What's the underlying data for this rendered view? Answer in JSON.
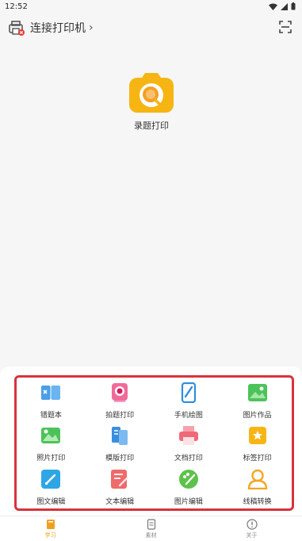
{
  "status": {
    "time": "12:52"
  },
  "header": {
    "connect_label": "连接打印机",
    "chevron": "›"
  },
  "center_app": {
    "label": "录题打印",
    "icon": "camera-search-icon",
    "color": "#f7b514"
  },
  "functions": [
    {
      "label": "错题本",
      "icon": "mistake-book-icon",
      "color": "#4a9fe6"
    },
    {
      "label": "拍题打印",
      "icon": "photo-question-icon",
      "color": "#f06a9a"
    },
    {
      "label": "手机绘图",
      "icon": "phone-drawing-icon",
      "color": "#2f8de0"
    },
    {
      "label": "图片作品",
      "icon": "image-works-icon",
      "color": "#4cc35a"
    },
    {
      "label": "照片打印",
      "icon": "photo-print-icon",
      "color": "#4cc35a"
    },
    {
      "label": "模版打印",
      "icon": "template-print-icon",
      "color": "#3a8ee0"
    },
    {
      "label": "文档打印",
      "icon": "document-print-icon",
      "color": "#ef6a78"
    },
    {
      "label": "标签打印",
      "icon": "label-print-icon",
      "color": "#f7b514"
    },
    {
      "label": "图文编辑",
      "icon": "image-text-edit-icon",
      "color": "#2ea6e6"
    },
    {
      "label": "文本编辑",
      "icon": "text-edit-icon",
      "color": "#ef6a6a"
    },
    {
      "label": "图片编辑",
      "icon": "image-edit-icon",
      "color": "#5cc24a"
    },
    {
      "label": "线稿转换",
      "icon": "line-art-convert-icon",
      "color": "#f5a623"
    }
  ],
  "tabs": [
    {
      "label": "学习",
      "icon": "study-book-icon",
      "active": true
    },
    {
      "label": "素材",
      "icon": "material-icon",
      "active": false
    },
    {
      "label": "关于",
      "icon": "about-info-icon",
      "active": false
    }
  ]
}
